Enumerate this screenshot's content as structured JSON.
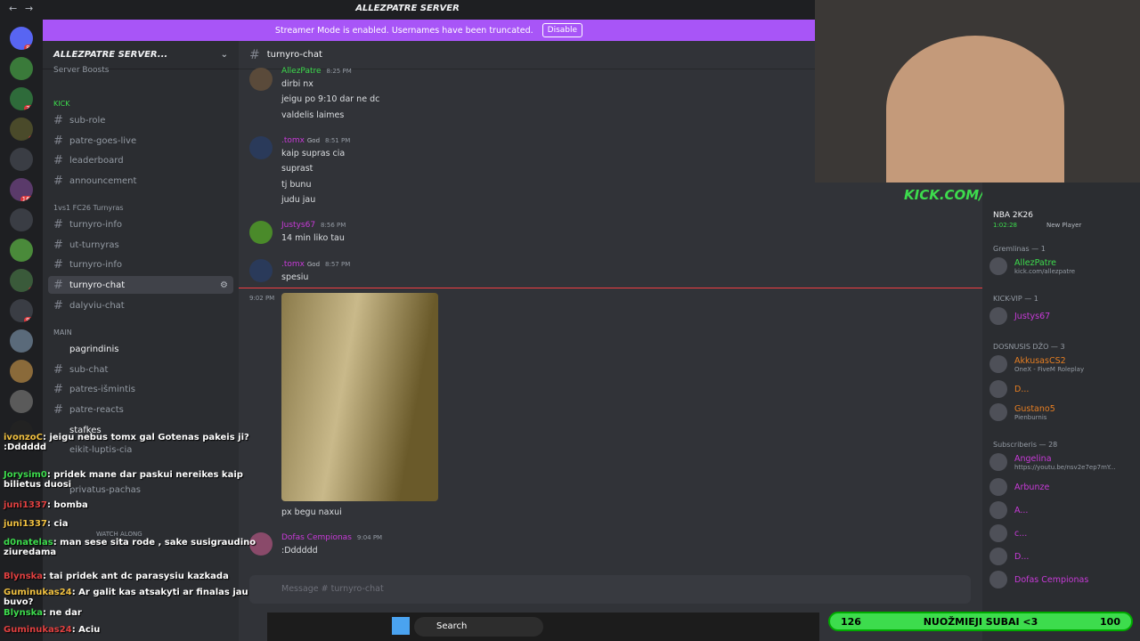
{
  "window": {
    "server_title": "ALLEZPATRE SERVER",
    "back": "←",
    "forward": "→"
  },
  "banner": {
    "text": "Streamer Mode is enabled. Usernames have been truncated.",
    "button": "Disable"
  },
  "sidebar": {
    "server_name": "ALLEZPATRE SERVER...",
    "server_boosts": "Server Boosts",
    "categories": [
      {
        "label": "KICK"
      },
      {
        "label": "1vs1 FC26 Turnyras"
      },
      {
        "label": "MAIN"
      }
    ],
    "channels": [
      "sub-role",
      "patre-goes-live",
      "leaderboard",
      "announcement",
      "turnyro-info",
      "ut-turnyras",
      "turnyro-info",
      "turnyro-chat",
      "dalyviu-chat",
      "pagrindinis",
      "sub-chat",
      "patres-išmintis",
      "patre-reacts",
      "stafkes",
      "eikit-luptis-cia",
      "privatus-pachas"
    ],
    "voice_user": "AllezPatre",
    "watch_along": "WATCH ALONG"
  },
  "chat": {
    "channel": "turnyro-chat",
    "placeholder": "Message # turnyro-chat",
    "messages": [
      {
        "author": "AllezPatre",
        "time": "8:25 PM",
        "lines": [
          "dirbi nx",
          "jeigu po 9:10 dar ne dc",
          "valdelis laimes"
        ]
      },
      {
        "author": ".tomx",
        "tag": "God",
        "time": "8:51 PM",
        "lines": [
          "kaip supras cia",
          "suprast",
          "tj bunu",
          "judu jau"
        ]
      },
      {
        "author": "Justys67",
        "time": "8:56 PM",
        "lines": [
          "14 min liko tau"
        ]
      },
      {
        "author": ".tomx",
        "tag": "God",
        "time": "8:57 PM",
        "lines": [
          "spesiu"
        ]
      },
      {
        "time_side": "9:02 PM",
        "lines": [
          "px begu naxui"
        ]
      },
      {
        "author": "Dofas Cempionas",
        "time": "9:04 PM",
        "lines": [
          ":Dddddd"
        ]
      }
    ]
  },
  "game": {
    "title": "NBA 2K26",
    "time": "1:02:28",
    "sub": "New Player"
  },
  "members": {
    "groups": [
      {
        "label": "Gremlinas — 1",
        "items": [
          {
            "name": "AllezPatre",
            "sub": "kick.com/allezpatre",
            "color": "#3ddc4d"
          }
        ]
      },
      {
        "label": "KICK-VIP — 1",
        "items": [
          {
            "name": "Justys67",
            "sub": "",
            "color": "#c83ad8"
          }
        ]
      },
      {
        "label": "DOSNUSIS DŽO — 3",
        "items": [
          {
            "name": "AkkusasCS2",
            "sub": "OneX - FiveM Roleplay",
            "color": "#e67e22"
          },
          {
            "name": "D...",
            "sub": "",
            "color": "#e67e22"
          },
          {
            "name": "Gustano5",
            "sub": "Pienburnis",
            "color": "#e67e22"
          }
        ]
      },
      {
        "label": "Subscriberis — 28",
        "items": [
          {
            "name": "Angelina",
            "sub": "https://youtu.be/nsv2e7ep7mY...",
            "color": "#c83ad8"
          },
          {
            "name": "Arbunze",
            "sub": "",
            "color": "#c83ad8"
          },
          {
            "name": "A...",
            "sub": "",
            "color": "#c83ad8"
          },
          {
            "name": "c...",
            "sub": "",
            "color": "#c83ad8"
          },
          {
            "name": "D...",
            "sub": "",
            "color": "#c83ad8"
          },
          {
            "name": "Dofas Cempionas",
            "sub": "",
            "color": "#c83ad8"
          }
        ]
      }
    ]
  },
  "stream": {
    "kick_url": "KICK.COM/ALLEZPATRE",
    "goal_left": "126",
    "goal_text": "NUOŽMIEJI SUBAI <3",
    "goal_right": "100"
  },
  "twitch_chat": [
    {
      "user": "ivonzoC",
      "text": ": jeigu nebus tomx gal Gotenas pakeis ji? :Dddddd"
    },
    {
      "user": "Jorysim0",
      "text": ": pridek mane dar paskui nereikes kaip bilietus duosi"
    },
    {
      "user": "juni1337",
      "text": ": bomba"
    },
    {
      "user": "juni1337",
      "text": ": cia"
    },
    {
      "user": "d0natelas",
      "text": ": man sese sita rode , sake susigraudino ziuredama"
    },
    {
      "user": "Blynska",
      "text": ": tai pridek ant dc parasysiu kazkada"
    },
    {
      "user": "Guminukas24",
      "text": ": Ar galit kas atsakyti ar finalas jau buvo?"
    },
    {
      "user": "Blynska",
      "text": ": ne dar"
    },
    {
      "user": "Guminukas24",
      "text": ": Aciu"
    }
  ],
  "taskbar": {
    "search": "Search"
  }
}
